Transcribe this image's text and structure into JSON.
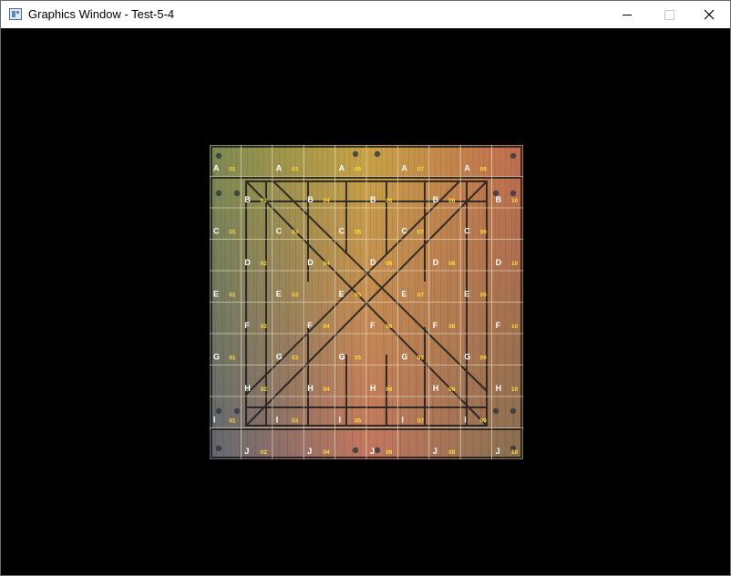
{
  "window": {
    "title": "Graphics Window - Test-5-4",
    "icon": "app-window-icon",
    "controls": {
      "minimize": "minimize-icon",
      "maximize": "maximize-icon",
      "close": "close-icon"
    }
  },
  "texture": {
    "description_icon": "wooden-crate-texture",
    "rows": [
      "A",
      "B",
      "C",
      "D",
      "E",
      "F",
      "G",
      "H",
      "I",
      "J"
    ],
    "cols": [
      "01",
      "02",
      "03",
      "04",
      "05",
      "06",
      "07",
      "08",
      "09",
      "10"
    ],
    "colors": {
      "top_left": "#7fa05a",
      "top_mid": "#e6c24a",
      "top_right": "#e0735a",
      "bottom_left": "#5a6e8a",
      "bottom_mid": "#e08070",
      "bottom_right": "#8a7a5a",
      "grid_line": "#f0e6c8",
      "label_letter": "#ffffff",
      "label_number": "#ffdd33",
      "plank_outline": "#1c1c1c"
    }
  }
}
